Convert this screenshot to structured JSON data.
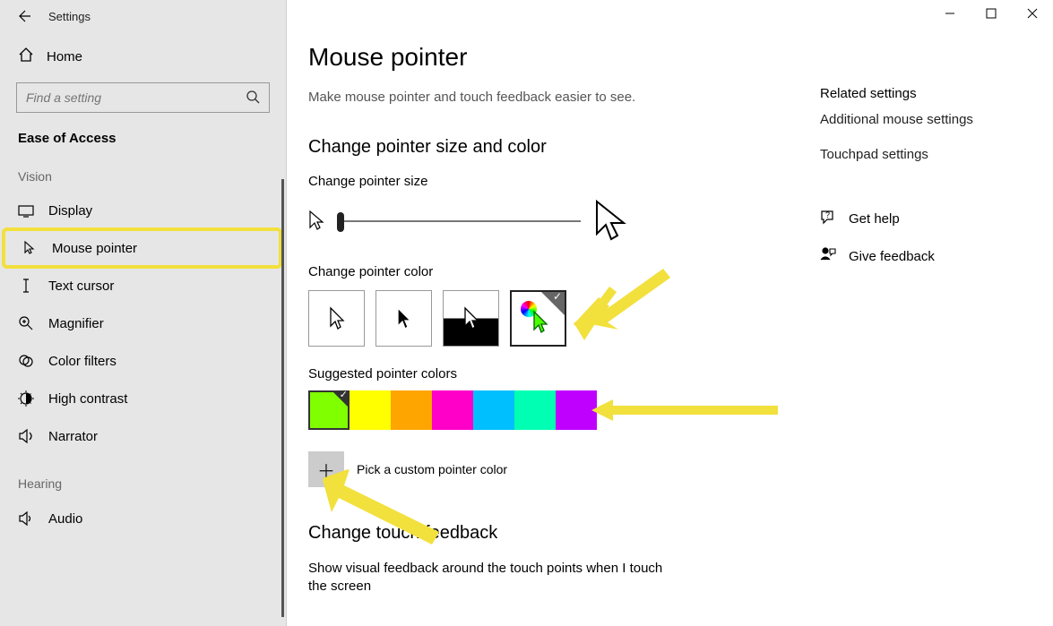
{
  "window": {
    "title": "Settings"
  },
  "sidebar": {
    "home": "Home",
    "search_placeholder": "Find a setting",
    "category": "Ease of Access",
    "groups": [
      {
        "label": "Vision",
        "items": [
          {
            "id": "display",
            "label": "Display"
          },
          {
            "id": "mouse-pointer",
            "label": "Mouse pointer",
            "active": true
          },
          {
            "id": "text-cursor",
            "label": "Text cursor"
          },
          {
            "id": "magnifier",
            "label": "Magnifier"
          },
          {
            "id": "color-filters",
            "label": "Color filters"
          },
          {
            "id": "high-contrast",
            "label": "High contrast"
          },
          {
            "id": "narrator",
            "label": "Narrator"
          }
        ]
      },
      {
        "label": "Hearing",
        "items": [
          {
            "id": "audio",
            "label": "Audio"
          }
        ]
      }
    ]
  },
  "page": {
    "title": "Mouse pointer",
    "subtitle": "Make mouse pointer and touch feedback easier to see.",
    "section_size_color": "Change pointer size and color",
    "size_label": "Change pointer size",
    "color_label": "Change pointer color",
    "suggested_label": "Suggested pointer colors",
    "custom_label": "Pick a custom pointer color",
    "section_touch": "Change touch feedback",
    "touch_desc": "Show visual feedback around the touch points when I touch the screen"
  },
  "pointer_color_options": [
    {
      "id": "white",
      "kind": "white"
    },
    {
      "id": "black",
      "kind": "black"
    },
    {
      "id": "inverted",
      "kind": "inverted"
    },
    {
      "id": "custom",
      "kind": "custom",
      "selected": true
    }
  ],
  "suggested_colors": [
    {
      "hex": "#7fff00",
      "selected": true
    },
    {
      "hex": "#ffff00"
    },
    {
      "hex": "#ffa500"
    },
    {
      "hex": "#ff00c8"
    },
    {
      "hex": "#00bfff"
    },
    {
      "hex": "#00ffb3"
    },
    {
      "hex": "#c000ff"
    }
  ],
  "right": {
    "heading": "Related settings",
    "links": [
      {
        "label": "Additional mouse settings"
      },
      {
        "label": "Touchpad settings"
      }
    ],
    "help": "Get help",
    "feedback": "Give feedback"
  }
}
